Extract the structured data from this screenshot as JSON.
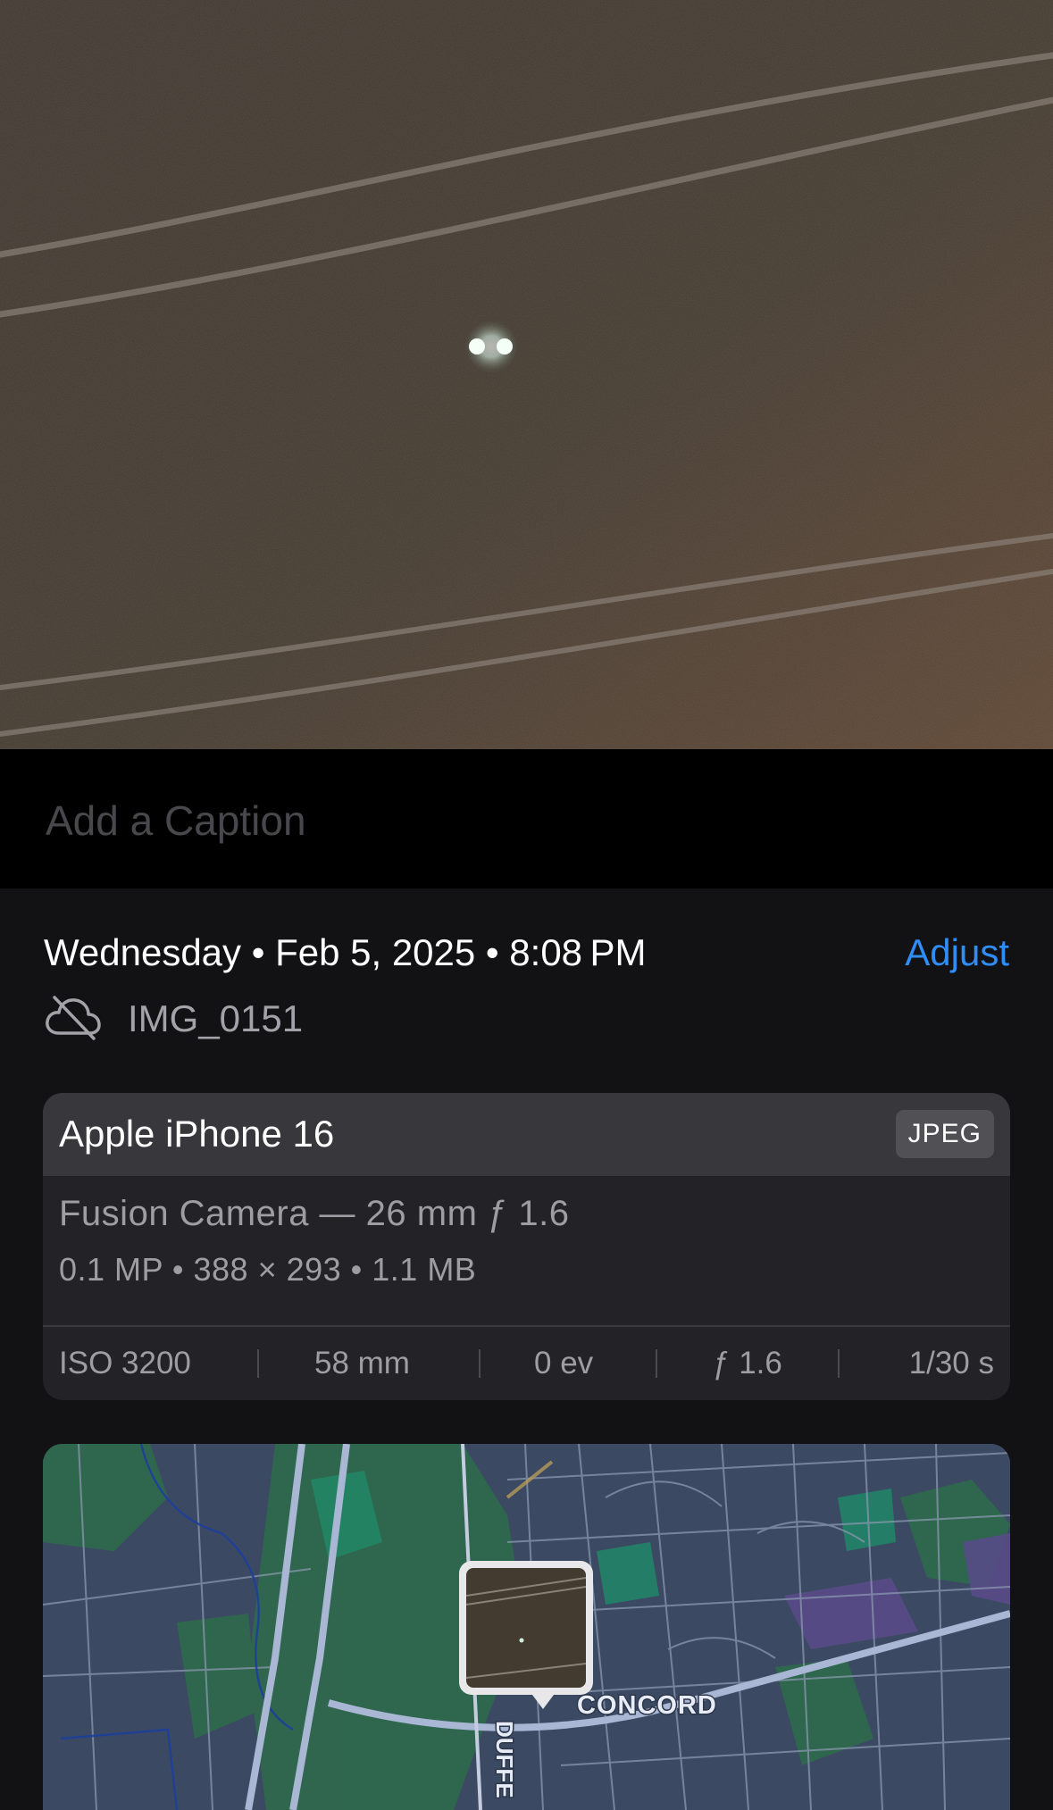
{
  "photo": {
    "description_icon": "photo-night-sky"
  },
  "caption": {
    "placeholder": "Add a Caption"
  },
  "info": {
    "datetime": "Wednesday • Feb 5, 2025 • 8:08 PM",
    "adjust_label": "Adjust",
    "cloud_icon": "cloud-off-icon",
    "filename": "IMG_0151"
  },
  "camera": {
    "device": "Apple iPhone 16",
    "format": "JPEG",
    "lens": "Fusion Camera — 26 mm ƒ 1.6",
    "resolution": "0.1 MP  •  388 × 293  •  1.1 MB",
    "exif": {
      "iso": "ISO 3200",
      "focal": "58 mm",
      "ev": "0 ev",
      "aperture": "ƒ 1.6",
      "shutter": "1/30 s"
    }
  },
  "map": {
    "place_label": "CONCORD",
    "road_label": "DUFFE"
  },
  "colors": {
    "accent": "#2f8df5",
    "background": "#121214",
    "card": "#232327",
    "card_header": "#38383c"
  }
}
